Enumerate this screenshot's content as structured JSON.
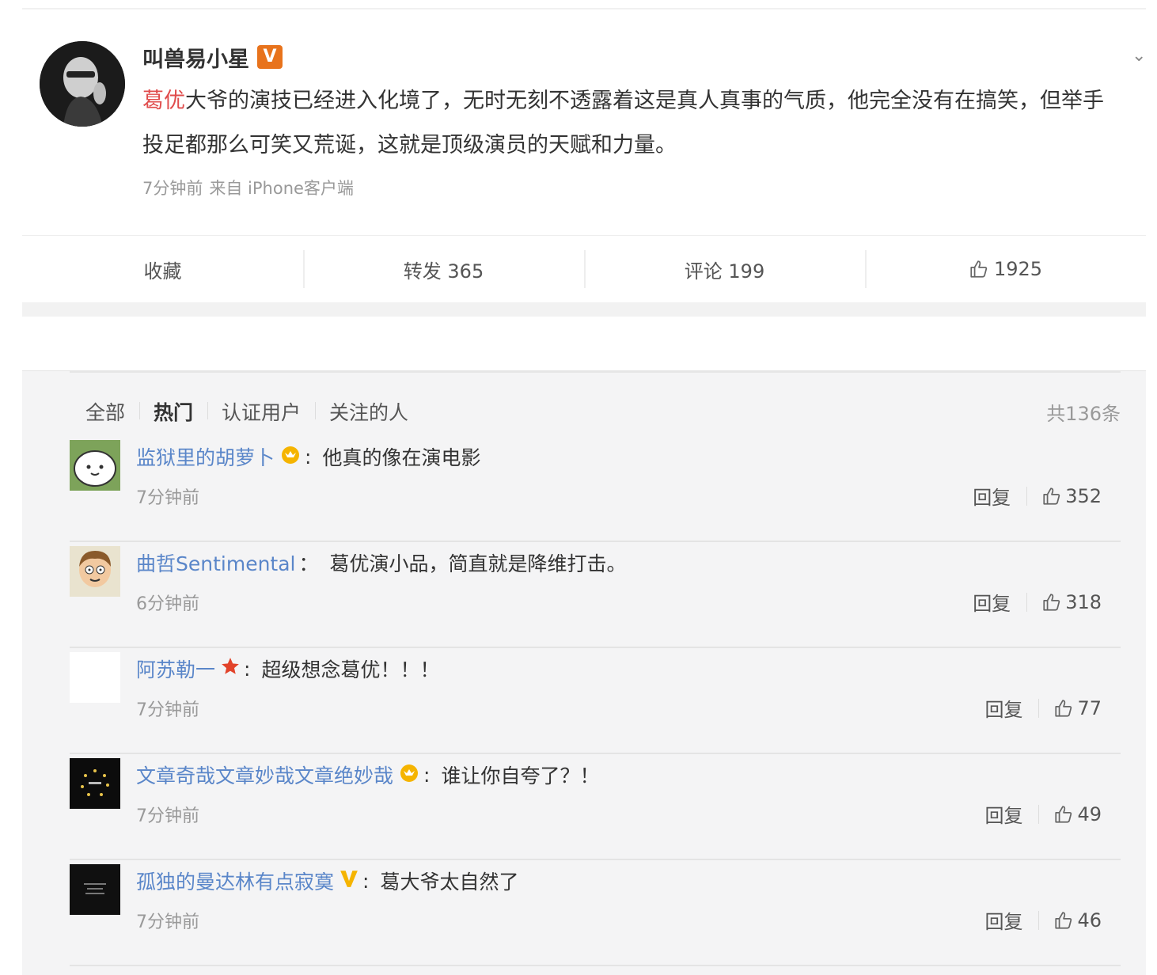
{
  "post": {
    "author": "叫兽易小星",
    "verified_badge": "V",
    "verified_icon": "verified-v-icon",
    "text_mention": "葛优",
    "text_body": "大爷的演技已经进入化境了，无时无刻不透露着这是真人真事的气质，他完全没有在搞笑，但举手投足都那么可笑又荒诞，这就是顶级演员的天赋和力量。",
    "time": "7分钟前",
    "source": "来自 iPhone客户端",
    "actions": {
      "favorite": "收藏",
      "repost": "转发 365",
      "comment": "评论 199",
      "like": "1925"
    },
    "colors": {
      "mention": "#e04c4c",
      "verified": "#e8731c"
    }
  },
  "comments": {
    "tabs": [
      "全部",
      "热门",
      "认证用户",
      "关注的人"
    ],
    "active_tab": "热门",
    "total": "共136条",
    "reply_label": "回复",
    "colors": {
      "username": "#5a86c9",
      "background": "#f4f4f5"
    },
    "items": [
      {
        "user": "监狱里的胡萝卜",
        "badge": "crown-icon",
        "text": "他真的像在演电影",
        "time": "7分钟前",
        "likes": "352"
      },
      {
        "user": "曲哲Sentimental",
        "badge": "",
        "text": "葛优演小品，简直就是降维打击。",
        "time": "6分钟前",
        "likes": "318"
      },
      {
        "user": "阿苏勒一",
        "badge": "star-icon",
        "text": "超级想念葛优！！！",
        "time": "7分钟前",
        "likes": "77"
      },
      {
        "user": "文章奇哉文章妙哉文章绝妙哉",
        "badge": "crown-icon",
        "text": "谁让你自夸了？！",
        "time": "7分钟前",
        "likes": "49"
      },
      {
        "user": "孤独的曼达林有点寂寞",
        "badge": "yellow-v-icon",
        "text": "葛大爷太自然了",
        "time": "7分钟前",
        "likes": "46"
      }
    ]
  }
}
